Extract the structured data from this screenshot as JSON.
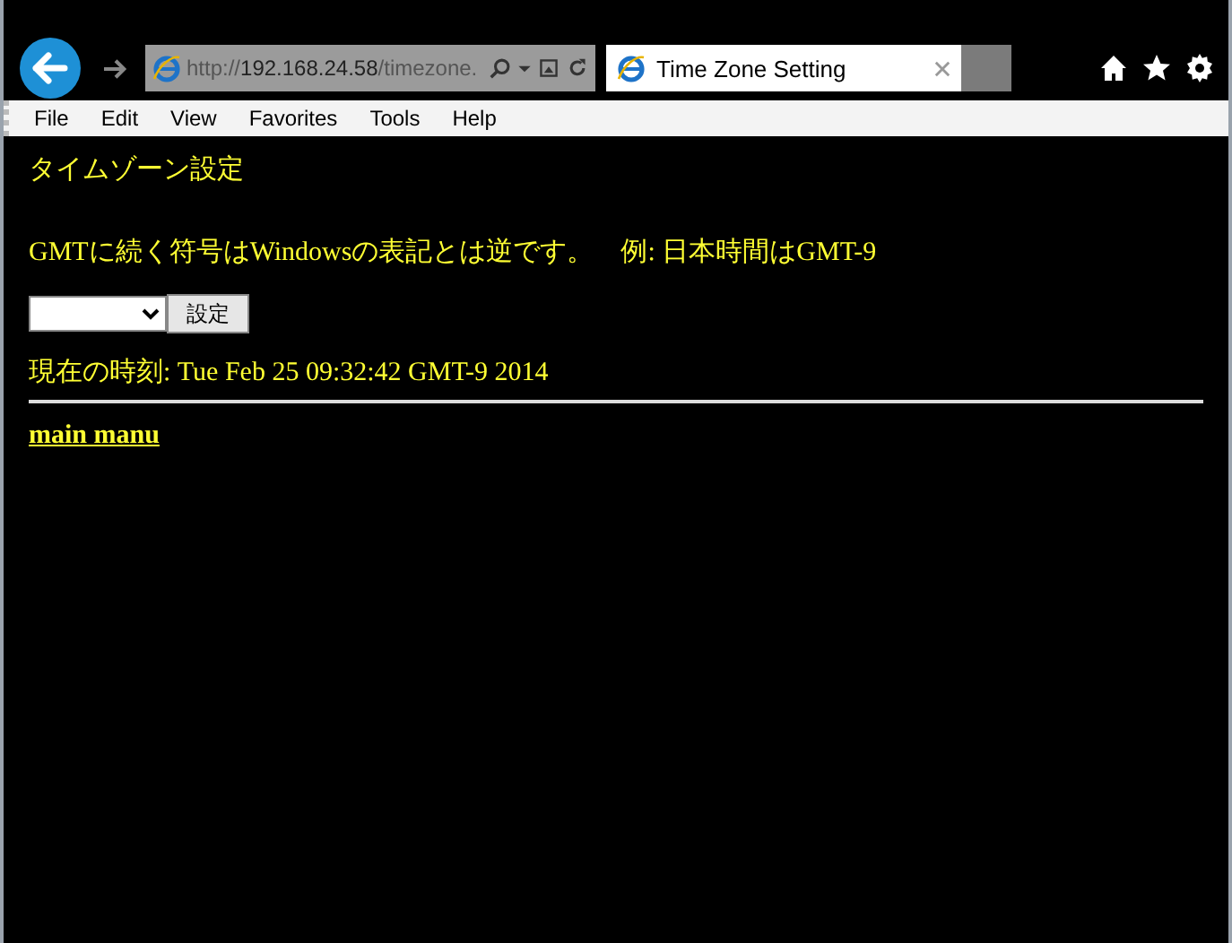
{
  "browser": {
    "address": {
      "scheme": "http://",
      "host": "192.168.24.58",
      "path": "/timezone."
    },
    "tabs": [
      {
        "title": "Time Zone Setting",
        "selected": true
      }
    ],
    "menu": [
      "File",
      "Edit",
      "View",
      "Favorites",
      "Tools",
      "Help"
    ]
  },
  "page": {
    "heading": "タイムゾーン設定",
    "note": "GMTに続く符号はWindowsの表記とは逆です。　例: 日本時間はGMT-9",
    "button": "設定",
    "current_time": "現在の時刻: Tue Feb 25 09:32:42 GMT-9 2014",
    "link": "main manu"
  }
}
